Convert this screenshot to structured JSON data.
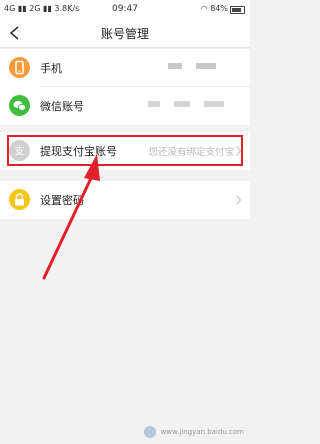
{
  "status_bar": {
    "network": "4G",
    "network2": "2G",
    "speed": "3.8K/s",
    "time": "09:47",
    "battery": "84%"
  },
  "nav": {
    "title": "账号管理"
  },
  "rows": {
    "phone": {
      "label": "手机",
      "icon": "phone-icon"
    },
    "wechat": {
      "label": "微信账号",
      "icon": "wechat-icon"
    },
    "alipay": {
      "label": "提现支付宝账号",
      "hint": "您还没有绑定支付宝",
      "icon": "alipay-icon"
    },
    "password": {
      "label": "设置密码",
      "icon": "lock-icon"
    }
  },
  "colors": {
    "phone": "#f39a3a",
    "wechat": "#3fbe3b",
    "alipay": "#d0d0d0",
    "password": "#f5c518",
    "highlight": "#e0202a"
  },
  "watermark": {
    "text": "www.jingyan.baidu.com"
  }
}
